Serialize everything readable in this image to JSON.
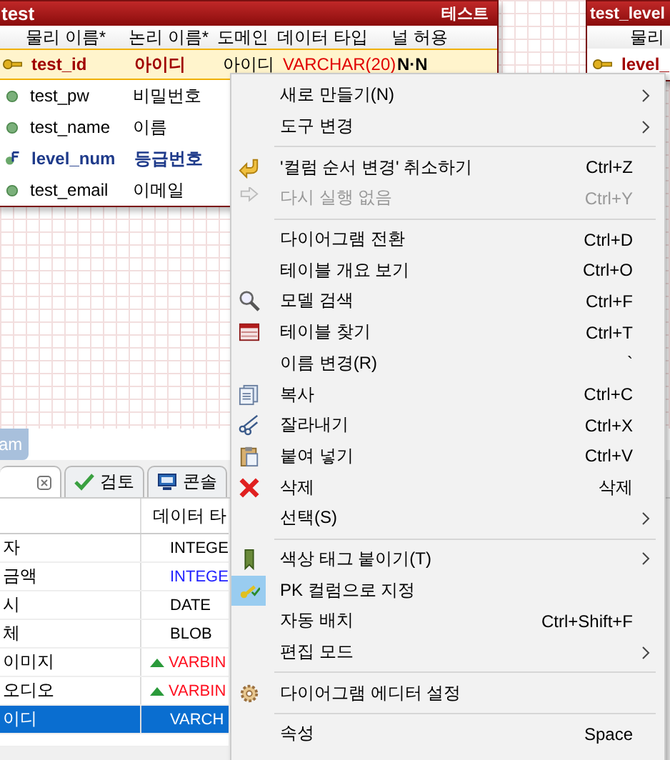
{
  "diagram": {
    "entities": [
      {
        "title": "test",
        "logical_title": "테스트",
        "columns": [
          "물리 이름*",
          "논리 이름*",
          "도메인",
          "데이터 타입",
          "널 허용"
        ],
        "rows": [
          {
            "kind": "pk",
            "physical": "test_id",
            "logical": "아이디",
            "domain": "아이디",
            "data_type": "VARCHAR(20)",
            "nullable": "N·N",
            "selected": true
          },
          {
            "kind": "column",
            "physical": "test_pw",
            "logical": "비밀번호",
            "selected": false
          },
          {
            "kind": "column",
            "physical": "test_name",
            "logical": "이름",
            "selected": false
          },
          {
            "kind": "fk",
            "physical": "level_num",
            "logical": "등급번호",
            "selected": false
          },
          {
            "kind": "column",
            "physical": "test_email",
            "logical": "이메일",
            "selected": false
          }
        ]
      },
      {
        "title": "test_level",
        "columns": [
          "물리"
        ],
        "rows": [
          {
            "kind": "pk",
            "physical": "level_",
            "selected": false
          }
        ]
      }
    ]
  },
  "diagram_tab": "am",
  "panel": {
    "tabs": [
      {
        "closable": true,
        "selected": true
      },
      {
        "label": "검토",
        "selected": false
      },
      {
        "label": "콘솔",
        "selected": false
      }
    ],
    "table": {
      "columns": [
        "데이터 타"
      ],
      "rows": [
        {
          "column_1": "자",
          "data_type": "INTEGE",
          "color": "#000000",
          "marker": false,
          "selected": false
        },
        {
          "column_1": "금액",
          "data_type": "INTEGE",
          "color": "#2020ff",
          "marker": false,
          "selected": false
        },
        {
          "column_1": "시",
          "data_type": "DATE",
          "color": "#000000",
          "marker": false,
          "selected": false
        },
        {
          "column_1": "체",
          "data_type": "BLOB",
          "color": "#000000",
          "marker": false,
          "selected": false
        },
        {
          "column_1": "이미지",
          "data_type": "VARBIN",
          "color": "#ff1020",
          "marker": true,
          "selected": false
        },
        {
          "column_1": "오디오",
          "data_type": "VARBIN",
          "color": "#ff1020",
          "marker": true,
          "selected": false
        },
        {
          "column_1": "이디",
          "data_type": "VARCH",
          "color": "#ffffff",
          "marker": false,
          "selected": true
        }
      ]
    }
  },
  "context_menu": [
    {
      "kind": "item",
      "label": "새로 만들기(N)",
      "submenu": true,
      "disabled": false
    },
    {
      "kind": "item",
      "label": "도구 변경",
      "submenu": true,
      "disabled": false
    },
    {
      "kind": "separator"
    },
    {
      "kind": "item",
      "label": "'컬럼 순서 변경' 취소하기",
      "shortcut": "Ctrl+Z",
      "submenu": false,
      "disabled": false
    },
    {
      "kind": "item",
      "label": "다시 실행 없음",
      "shortcut": "Ctrl+Y",
      "submenu": false,
      "disabled": true
    },
    {
      "kind": "separator"
    },
    {
      "kind": "item",
      "label": "다이어그램 전환",
      "shortcut": "Ctrl+D",
      "submenu": false,
      "disabled": false
    },
    {
      "kind": "item",
      "label": "테이블 개요 보기",
      "shortcut": "Ctrl+O",
      "submenu": false,
      "disabled": false
    },
    {
      "kind": "item",
      "label": "모델 검색",
      "shortcut": "Ctrl+F",
      "submenu": false,
      "disabled": false
    },
    {
      "kind": "item",
      "label": "테이블 찾기",
      "shortcut": "Ctrl+T",
      "submenu": false,
      "disabled": false
    },
    {
      "kind": "item",
      "label": "이름 변경(R)",
      "shortcut": "`",
      "submenu": false,
      "disabled": false
    },
    {
      "kind": "item",
      "label": "복사",
      "shortcut": "Ctrl+C",
      "submenu": false,
      "disabled": false
    },
    {
      "kind": "item",
      "label": "잘라내기",
      "shortcut": "Ctrl+X",
      "submenu": false,
      "disabled": false
    },
    {
      "kind": "item",
      "label": "붙여 넣기",
      "shortcut": "Ctrl+V",
      "submenu": false,
      "disabled": false
    },
    {
      "kind": "item",
      "label": "삭제",
      "shortcut": "삭제",
      "submenu": false,
      "disabled": false
    },
    {
      "kind": "item",
      "label": "선택(S)",
      "submenu": true,
      "disabled": false
    },
    {
      "kind": "separator"
    },
    {
      "kind": "item",
      "label": "색상 태그 붙이기(T)",
      "submenu": true,
      "disabled": false
    },
    {
      "kind": "item",
      "label": "PK 컬럼으로 지정",
      "submenu": false,
      "disabled": false
    },
    {
      "kind": "item",
      "label": "자동 배치",
      "shortcut": "Ctrl+Shift+F",
      "submenu": false,
      "disabled": false
    },
    {
      "kind": "item",
      "label": "편집 모드",
      "submenu": true,
      "disabled": false
    },
    {
      "kind": "separator"
    },
    {
      "kind": "item",
      "label": "다이어그램 에디터 설정",
      "submenu": false,
      "disabled": false
    },
    {
      "kind": "separator"
    },
    {
      "kind": "item",
      "label": "속성",
      "shortcut": "Space",
      "submenu": false,
      "disabled": false
    }
  ]
}
